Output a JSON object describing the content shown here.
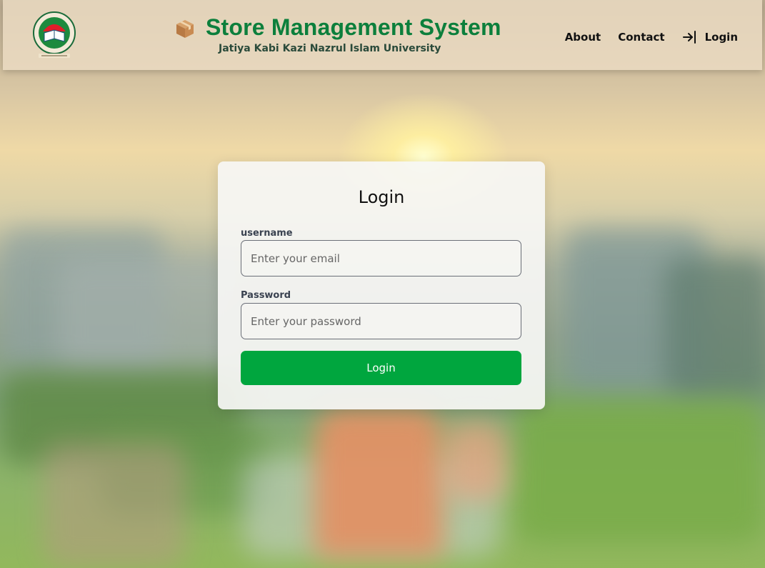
{
  "header": {
    "logo_icon": "university-logo-icon",
    "brand_icon": "package-box-icon",
    "title": "Store Management System",
    "subtitle": "Jatiya Kabi Kazi Nazrul Islam University",
    "title_color": "#0c7f3c",
    "nav": {
      "about": "About",
      "contact": "Contact",
      "login": "Login",
      "login_icon": "sign-in-arrow-icon"
    }
  },
  "login_form": {
    "title": "Login",
    "username_label": "username",
    "username_placeholder": "Enter your email",
    "username_value": "",
    "password_label": "Password",
    "password_placeholder": "Enter your password",
    "password_value": "",
    "submit_label": "Login",
    "submit_color": "#00a63e"
  }
}
